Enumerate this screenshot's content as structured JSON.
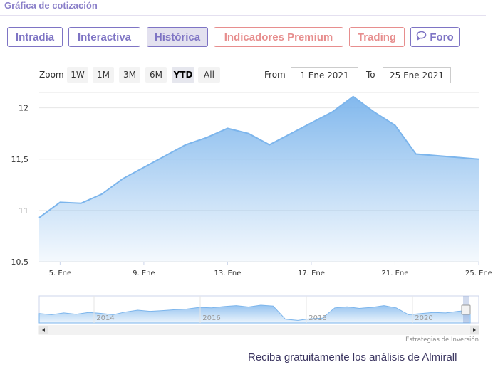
{
  "section": {
    "title": "Gráfica de cotización"
  },
  "tabs": [
    {
      "label": "Intradía",
      "active": false,
      "premium": false
    },
    {
      "label": "Interactiva",
      "active": false,
      "premium": false
    },
    {
      "label": "Histórica",
      "active": true,
      "premium": false
    },
    {
      "label": "Indicadores Premium",
      "active": false,
      "premium": true
    },
    {
      "label": "Trading",
      "active": false,
      "premium": true
    },
    {
      "label": "Foro",
      "active": false,
      "premium": false,
      "icon": "chat-bubble-icon"
    }
  ],
  "zoom": {
    "label": "Zoom",
    "options": [
      "1W",
      "1M",
      "3M",
      "6M",
      "YTD",
      "All"
    ],
    "selected": "YTD"
  },
  "range": {
    "from_label": "From",
    "from_value": "1 Ene 2021",
    "to_label": "To",
    "to_value": "25 Ene 2021"
  },
  "chart_data": {
    "type": "area",
    "title": "",
    "xlabel": "",
    "ylabel": "",
    "x_ticks": [
      "5. Ene",
      "9. Ene",
      "13. Ene",
      "17. Ene",
      "21. Ene",
      "25. Ene"
    ],
    "y_ticks": [
      "12",
      "11,5",
      "11",
      "10,5"
    ],
    "ylim": [
      10.5,
      12.15
    ],
    "xlim": [
      "2021-01-04",
      "2021-01-25"
    ],
    "series": [
      {
        "x": [
          "2021-01-04",
          "2021-01-05",
          "2021-01-06",
          "2021-01-07",
          "2021-01-08",
          "2021-01-11",
          "2021-01-12",
          "2021-01-13",
          "2021-01-14",
          "2021-01-15",
          "2021-01-18",
          "2021-01-19",
          "2021-01-20",
          "2021-01-21",
          "2021-01-22",
          "2021-01-25"
        ],
        "values": [
          10.93,
          11.08,
          11.07,
          11.16,
          11.31,
          11.64,
          11.71,
          11.8,
          11.75,
          11.64,
          11.96,
          12.11,
          11.96,
          11.83,
          11.55,
          11.5
        ]
      }
    ],
    "color": "#7cb5ec",
    "grid": true,
    "navigator": {
      "labels": [
        "2014",
        "2016",
        "2018",
        "2020"
      ]
    },
    "credit": "Estrategias de Inversión"
  },
  "footer": {
    "text": "Reciba gratuitamente los análisis de Almirall"
  }
}
